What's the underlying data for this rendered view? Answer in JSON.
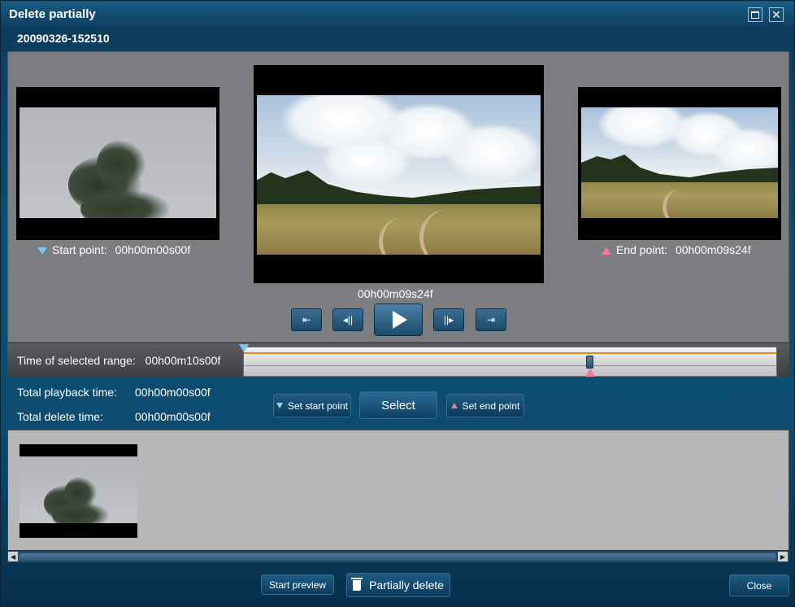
{
  "window": {
    "title": "Delete partially",
    "filename": "20090326-152510"
  },
  "preview": {
    "start_label": "Start point:",
    "start_time": "00h00m00s00f",
    "end_label": "End point:",
    "end_time": "00h00m09s24f",
    "current_time": "00h00m09s24f"
  },
  "controls": {
    "first": "⇤",
    "prev_frame": "◂||",
    "next_frame": "||▸",
    "last": "⇥"
  },
  "range": {
    "label": "Time of selected range:",
    "value": "00h00m10s00f",
    "start_marker_fraction": 0.0,
    "end_marker_fraction": 0.65
  },
  "info": {
    "playback_label": "Total playback time:",
    "playback_value": "00h00m00s00f",
    "delete_label": "Total delete time:",
    "delete_value": "00h00m00s00f"
  },
  "buttons": {
    "set_start": "Set start point",
    "select": "Select",
    "set_end": "Set end point",
    "start_preview": "Start preview",
    "partially_delete": "Partially delete",
    "close": "Close"
  },
  "colors": {
    "start_marker": "#7ec3ee",
    "end_marker": "#f07a9a",
    "range_line": "#d88a2a"
  }
}
